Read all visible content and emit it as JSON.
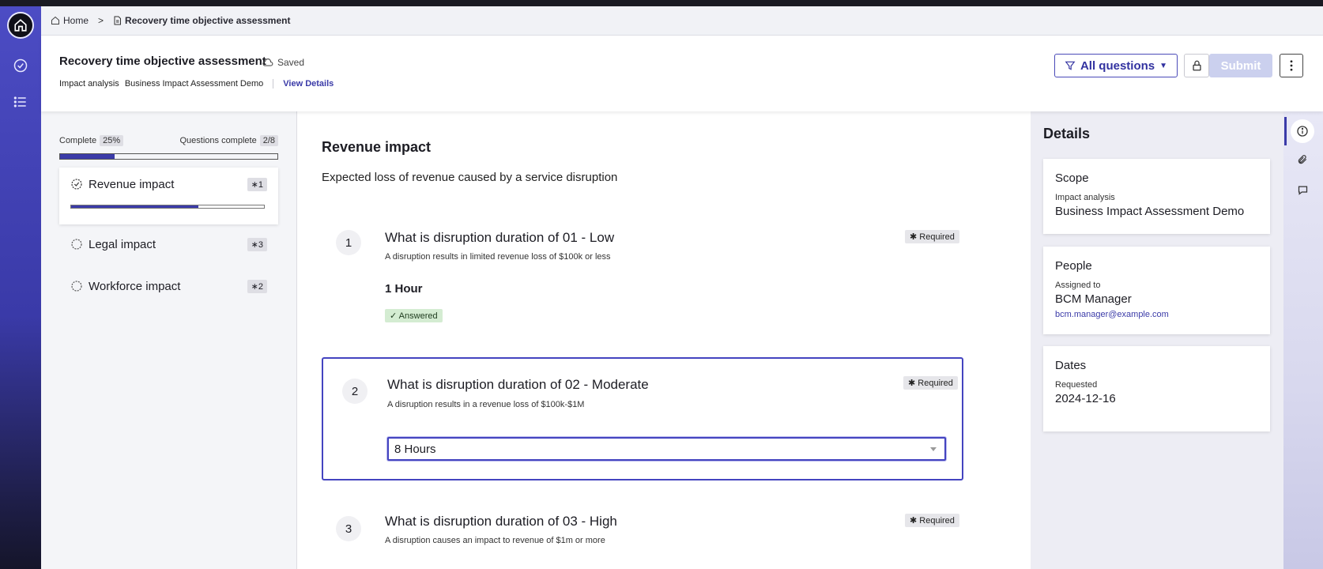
{
  "breadcrumb": {
    "home": "Home",
    "current": "Recovery time objective assessment"
  },
  "header": {
    "title": "Recovery time objective assessment",
    "saved": "Saved",
    "sub_label": "Impact analysis",
    "sub_value": "Business Impact Assessment Demo",
    "view_details": "View Details",
    "filter_label": "All questions",
    "submit_label": "Submit"
  },
  "progress": {
    "complete_label": "Complete",
    "complete_pct": "25%",
    "complete_fraction": 0.25,
    "questions_label": "Questions complete",
    "questions_value": "2/8"
  },
  "sections": [
    {
      "label": "Revenue impact",
      "count": "∗1",
      "progress": 0.66
    },
    {
      "label": "Legal impact",
      "count": "∗3"
    },
    {
      "label": "Workforce impact",
      "count": "∗2"
    }
  ],
  "main": {
    "title": "Revenue impact",
    "description": "Expected loss of revenue caused by a service disruption",
    "required_label": "Required",
    "questions": [
      {
        "number": "1",
        "title": "What is disruption duration of 01 - Low",
        "help": "A disruption results in limited revenue loss of $100k or less",
        "answer": "1 Hour",
        "status": "Answered"
      },
      {
        "number": "2",
        "title": "What is disruption duration of 02 - Moderate",
        "help": "A disruption results in a revenue loss of $100k-$1M",
        "select_value": "8 Hours"
      },
      {
        "number": "3",
        "title": "What is disruption duration of 03 - High",
        "help": "A disruption causes an impact to revenue of $1m or more"
      }
    ]
  },
  "details": {
    "title": "Details",
    "scope": {
      "heading": "Scope",
      "label": "Impact analysis",
      "value": "Business Impact Assessment Demo"
    },
    "people": {
      "heading": "People",
      "label": "Assigned to",
      "value": "BCM Manager",
      "email": "bcm.manager@example.com"
    },
    "dates": {
      "heading": "Dates",
      "label": "Requested",
      "value": "2024-12-16"
    }
  },
  "colors": {
    "accent": "#3b3ba8",
    "rail": "#4c4cc4",
    "answered_bg": "#d4ecd2",
    "submit_disabled": "#cbd0ee"
  },
  "icons": [
    "home-icon",
    "check-circle-icon",
    "list-icon",
    "file-icon",
    "cloud-icon",
    "filter-icon",
    "lock-icon",
    "kebab-icon",
    "info-icon",
    "paperclip-icon",
    "comment-icon"
  ]
}
